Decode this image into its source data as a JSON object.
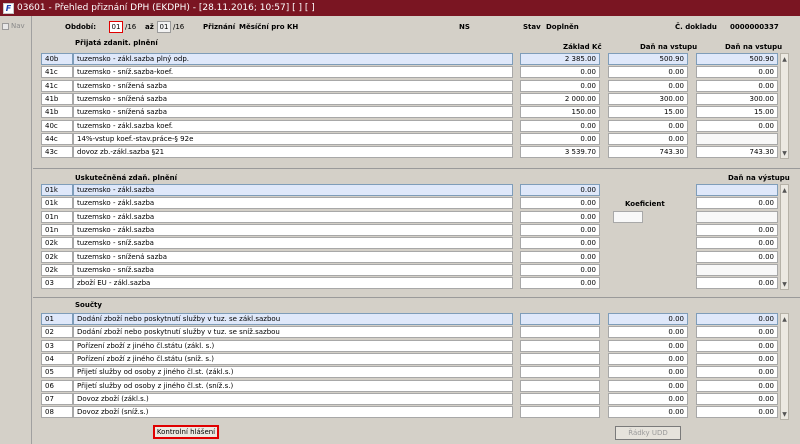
{
  "window": {
    "title": "03601 - Přehled přiznání DPH (EKDPH) - [28.11.2016; 10:57]  [ ]  [ ]"
  },
  "nav": {
    "label": "Nav"
  },
  "header": {
    "obdobi_label": "Období:",
    "obdobi_from_month": "01",
    "obdobi_from_year": "/16",
    "az_label": "až",
    "obdobi_to_month": "01",
    "obdobi_to_year": "/16",
    "priznani_label": "Přiznání",
    "priznani_value": "Měsíční pro KH",
    "ns_label": "NS",
    "stav_label": "Stav",
    "stav_value": "Doplněn",
    "doklad_label": "Č. dokladu",
    "doklad_value": "0000000337"
  },
  "section1": {
    "title": "Přijatá zdanit. plnění",
    "col_zaklad": "Základ Kč",
    "col_dan1": "Daň na vstupu",
    "col_dan2": "Daň na vstupu",
    "rows": [
      {
        "code": "40b",
        "desc": "tuzemsko - zákl.sazba plný odp.",
        "zaklad": "2 385.00",
        "dan1": "500.90",
        "dan2": "500.90"
      },
      {
        "code": "41c",
        "desc": "tuzemsko - sníž.sazba-koef.",
        "zaklad": "0.00",
        "dan1": "0.00",
        "dan2": "0.00"
      },
      {
        "code": "41c",
        "desc": "tuzemsko - snížená sazba",
        "zaklad": "0.00",
        "dan1": "0.00",
        "dan2": "0.00"
      },
      {
        "code": "41b",
        "desc": "tuzemsko - snížená sazba",
        "zaklad": "2 000.00",
        "dan1": "300.00",
        "dan2": "300.00"
      },
      {
        "code": "41b",
        "desc": "tuzemsko - snížená sazba",
        "zaklad": "150.00",
        "dan1": "15.00",
        "dan2": "15.00"
      },
      {
        "code": "40c",
        "desc": "tuzemsko - zákl.sazba koef.",
        "zaklad": "0.00",
        "dan1": "0.00",
        "dan2": "0.00"
      },
      {
        "code": "44c",
        "desc": "14%-vstup koef.-stav.práce-§ 92e",
        "zaklad": "0.00",
        "dan1": "0.00",
        "dan2": ""
      },
      {
        "code": "43c",
        "desc": "dovoz zb.-zákl.sazba §21",
        "zaklad": "3 539.70",
        "dan1": "743.30",
        "dan2": "743.30"
      }
    ]
  },
  "section2": {
    "title": "Uskutečněná zdaň. plnění",
    "col_dan": "Daň na výstupu",
    "koeficient_label": "Koeficient",
    "rows": [
      {
        "code": "01k",
        "desc": "tuzemsko - zákl.sazba",
        "zaklad": "0.00",
        "dan": ""
      },
      {
        "code": "01k",
        "desc": "tuzemsko - zákl.sazba",
        "zaklad": "0.00",
        "dan": "0.00"
      },
      {
        "code": "01n",
        "desc": "tuzemsko - zákl.sazba",
        "zaklad": "0.00",
        "dan": ""
      },
      {
        "code": "01n",
        "desc": "tuzemsko - zákl.sazba",
        "zaklad": "0.00",
        "dan": "0.00"
      },
      {
        "code": "02k",
        "desc": "tuzemsko - sníž.sazba",
        "zaklad": "0.00",
        "dan": "0.00"
      },
      {
        "code": "02k",
        "desc": "tuzemsko - snížená sazba",
        "zaklad": "0.00",
        "dan": "0.00"
      },
      {
        "code": "02k",
        "desc": "tuzemsko - sníž.sazba",
        "zaklad": "0.00",
        "dan": ""
      },
      {
        "code": "03",
        "desc": "zboží EU - zákl.sazba",
        "zaklad": "0.00",
        "dan": "0.00"
      }
    ]
  },
  "section3": {
    "title": "Součty",
    "rows": [
      {
        "code": "01",
        "desc": "Dodání zboží nebo poskytnutí služby v tuz. se zákl.sazbou",
        "zaklad": "",
        "dan1": "0.00",
        "dan2": "0.00"
      },
      {
        "code": "02",
        "desc": "Dodání zboží nebo poskytnutí služby v tuz. se sníž.sazbou",
        "zaklad": "",
        "dan1": "0.00",
        "dan2": "0.00"
      },
      {
        "code": "03",
        "desc": "Pořízení zboží z jiného čl.státu (zákl. s.)",
        "zaklad": "",
        "dan1": "0.00",
        "dan2": "0.00"
      },
      {
        "code": "04",
        "desc": "Pořízení zboží z jiného čl.státu (sníž. s.)",
        "zaklad": "",
        "dan1": "0.00",
        "dan2": "0.00"
      },
      {
        "code": "05",
        "desc": "Přijetí služby od osoby z jiného čl.st. (zákl.s.)",
        "zaklad": "",
        "dan1": "0.00",
        "dan2": "0.00"
      },
      {
        "code": "06",
        "desc": "Přijetí služby od osoby z jiného čl.st. (sníž.s.)",
        "zaklad": "",
        "dan1": "0.00",
        "dan2": "0.00"
      },
      {
        "code": "07",
        "desc": "Dovoz zboží (zákl.s.)",
        "zaklad": "",
        "dan1": "0.00",
        "dan2": "0.00"
      },
      {
        "code": "08",
        "desc": "Dovoz zboží (sníž.s.)",
        "zaklad": "",
        "dan1": "0.00",
        "dan2": "0.00"
      }
    ]
  },
  "buttons": {
    "kontrolni": "Kontrolní hlášení",
    "radky": "Řádky UDD"
  }
}
